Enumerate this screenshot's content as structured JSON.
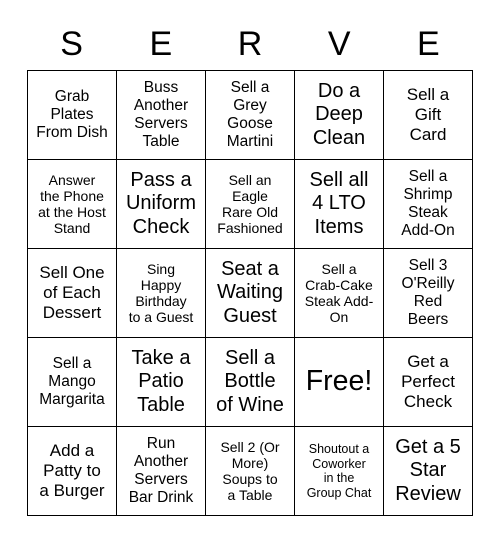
{
  "card": {
    "header_letters": [
      "S",
      "E",
      "R",
      "V",
      "E"
    ],
    "cells": [
      {
        "text": "Grab\nPlates\nFrom Dish",
        "size": "fs-md"
      },
      {
        "text": "Buss\nAnother\nServers\nTable",
        "size": "fs-md"
      },
      {
        "text": "Sell a\nGrey\nGoose\nMartini",
        "size": "fs-md"
      },
      {
        "text": "Do a\nDeep\nClean",
        "size": "fs-xl"
      },
      {
        "text": "Sell a\nGift\nCard",
        "size": "fs-lg"
      },
      {
        "text": "Answer\nthe Phone\nat the Host\nStand",
        "size": "fs-sm"
      },
      {
        "text": "Pass a\nUniform\nCheck",
        "size": "fs-xl"
      },
      {
        "text": "Sell an\nEagle\nRare Old\nFashioned",
        "size": "fs-sm"
      },
      {
        "text": "Sell all\n4 LTO\nItems",
        "size": "fs-xl"
      },
      {
        "text": "Sell a\nShrimp\nSteak\nAdd-On",
        "size": "fs-md"
      },
      {
        "text": "Sell One\nof Each\nDessert",
        "size": "fs-lg"
      },
      {
        "text": "Sing\nHappy\nBirthday\nto a Guest",
        "size": "fs-sm"
      },
      {
        "text": "Seat a\nWaiting\nGuest",
        "size": "fs-xl"
      },
      {
        "text": "Sell a\nCrab-Cake\nSteak Add-\nOn",
        "size": "fs-sm"
      },
      {
        "text": "Sell 3\nO'Reilly\nRed\nBeers",
        "size": "fs-md"
      },
      {
        "text": "Sell a\nMango\nMargarita",
        "size": "fs-md"
      },
      {
        "text": "Take a\nPatio\nTable",
        "size": "fs-xl"
      },
      {
        "text": "Sell a\nBottle\nof Wine",
        "size": "fs-xl"
      },
      {
        "text": "Free!",
        "size": "fs-xxl"
      },
      {
        "text": "Get a\nPerfect\nCheck",
        "size": "fs-lg"
      },
      {
        "text": "Add a\nPatty to\na Burger",
        "size": "fs-lg"
      },
      {
        "text": "Run\nAnother\nServers\nBar Drink",
        "size": "fs-md"
      },
      {
        "text": "Sell 2 (Or\nMore)\nSoups to\na Table",
        "size": "fs-sm"
      },
      {
        "text": "Shoutout a\nCoworker\nin the\nGroup Chat",
        "size": "fs-xs"
      },
      {
        "text": "Get a 5\nStar\nReview",
        "size": "fs-xl"
      }
    ]
  }
}
